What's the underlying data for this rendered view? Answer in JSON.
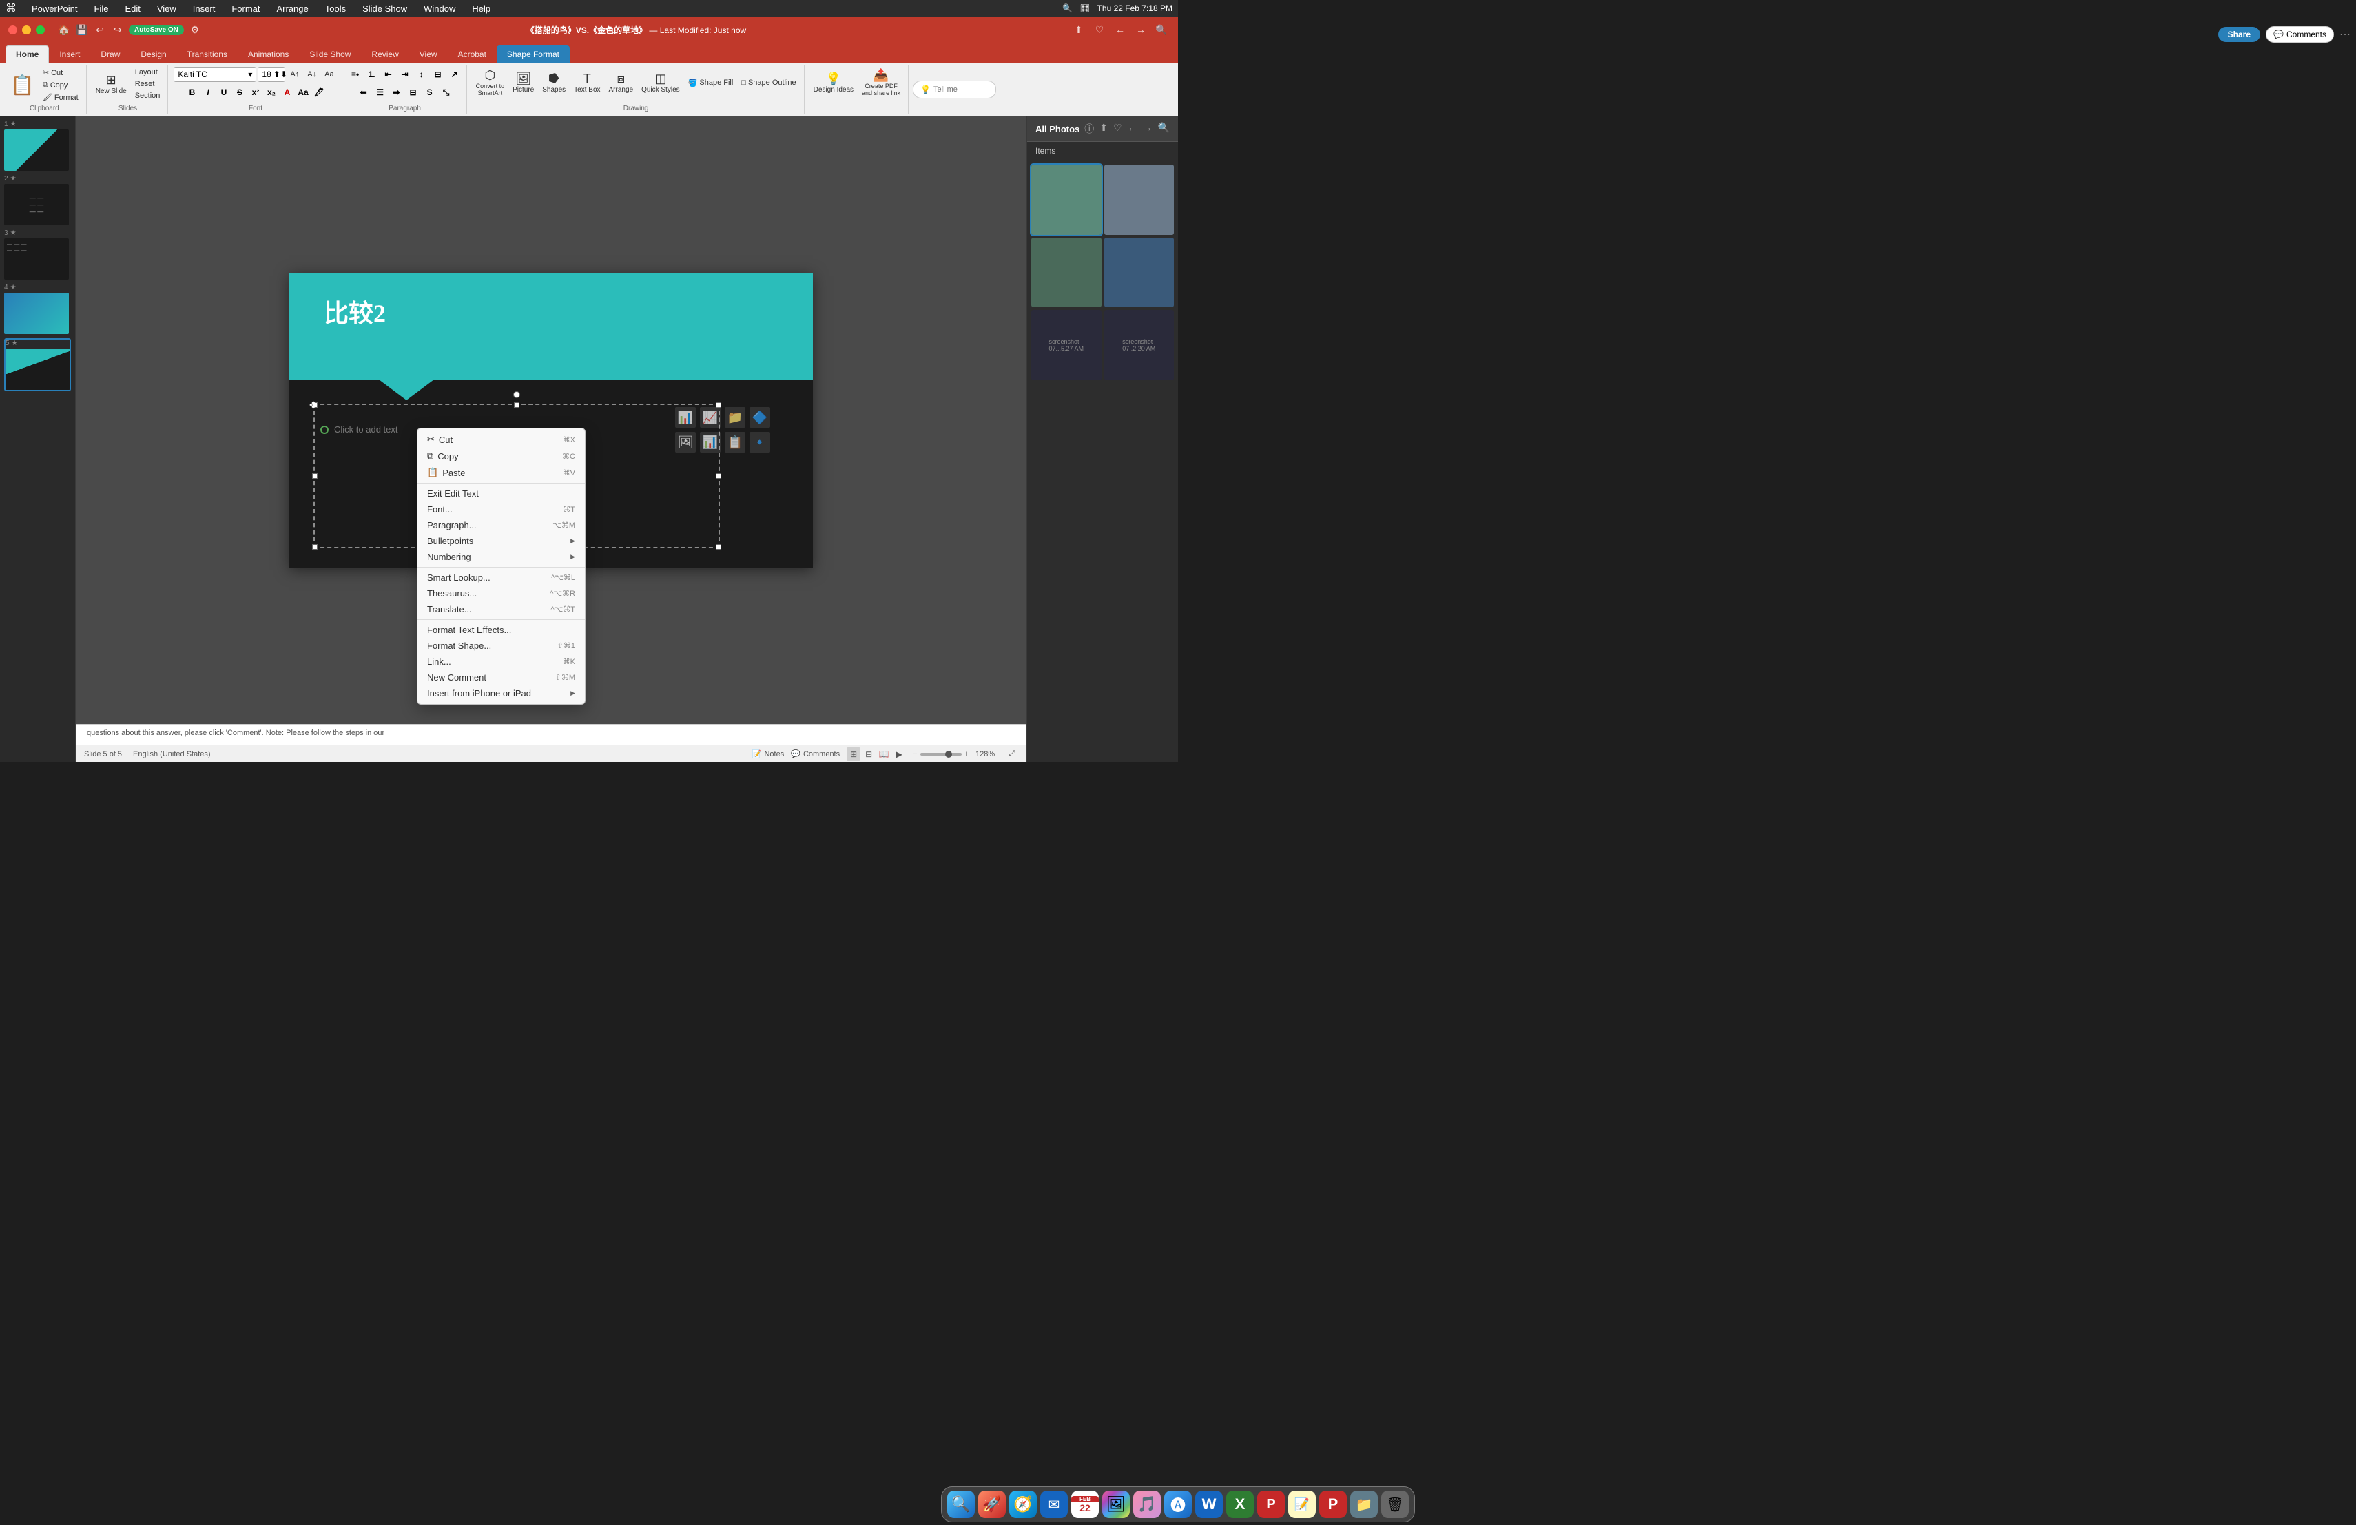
{
  "app": {
    "name": "PowerPoint",
    "title": "《搭船的鸟》VS.《金色的草地》",
    "subtitle": "— Last Modified: Just now",
    "autosave": "AutoSave ON"
  },
  "macos_menubar": {
    "items": [
      "PowerPoint",
      "File",
      "Edit",
      "View",
      "Insert",
      "Format",
      "Arrange",
      "Tools",
      "Slide Show",
      "Window",
      "Help"
    ],
    "time": "Thu 22 Feb  7:18 PM"
  },
  "ribbon": {
    "tabs": [
      "Home",
      "Insert",
      "Draw",
      "Design",
      "Transitions",
      "Animations",
      "Slide Show",
      "Review",
      "View",
      "Acrobat",
      "Shape Format"
    ],
    "active_tab": "Home",
    "contextual_tab": "Shape Format",
    "font": "Kaiti TC",
    "font_size": "18",
    "groups": {
      "clipboard": {
        "label": "Clipboard",
        "paste_label": "Paste",
        "cut_label": "Cut",
        "copy_label": "Copy",
        "format_label": "Format"
      },
      "slides": {
        "label": "Slides",
        "new_slide_label": "New Slide",
        "layout_label": "Layout",
        "reset_label": "Reset",
        "section_label": "Section"
      },
      "font": {
        "label": "Font"
      },
      "paragraph": {
        "label": "Paragraph"
      },
      "drawing": {
        "label": "Drawing",
        "shapes_label": "Shapes",
        "arrange_label": "Arrange",
        "quick_styles_label": "Quick Styles",
        "shape_fill_label": "Shape Fill",
        "shape_outline_label": "Shape Outline"
      },
      "insert": {
        "picture_label": "Picture",
        "text_box_label": "Text Box",
        "convert_label": "Convert to SmartArt"
      },
      "design": {
        "quick_styles_label": "Quick Styles",
        "design_ideas_label": "Design Ideas",
        "create_pdf_label": "Create PDF and share link"
      }
    },
    "tell_me_placeholder": "Tell me",
    "share_label": "Share",
    "comments_label": "Comments"
  },
  "slides": [
    {
      "number": "1",
      "starred": true,
      "thumb_style": "st1"
    },
    {
      "number": "2",
      "starred": true,
      "thumb_style": "st2"
    },
    {
      "number": "3",
      "starred": true,
      "thumb_style": "st3"
    },
    {
      "number": "4",
      "starred": true,
      "thumb_style": "st4"
    },
    {
      "number": "5",
      "starred": true,
      "thumb_style": "st5",
      "active": true
    }
  ],
  "current_slide": {
    "title": "比较2",
    "click_to_add_text": "Click to add text"
  },
  "context_menu": {
    "items": [
      {
        "text": "Cut",
        "shortcut": "⌘X",
        "divider_after": false
      },
      {
        "text": "Copy",
        "shortcut": "⌘C",
        "divider_after": false
      },
      {
        "text": "Paste",
        "shortcut": "⌘V",
        "divider_after": true
      },
      {
        "text": "Exit Edit Text",
        "shortcut": "",
        "divider_after": false
      },
      {
        "text": "Font...",
        "shortcut": "⌘T",
        "divider_after": false
      },
      {
        "text": "Paragraph...",
        "shortcut": "⌥⌘M",
        "divider_after": false
      },
      {
        "text": "Bulletpoints",
        "shortcut": "",
        "has_submenu": true,
        "divider_after": false
      },
      {
        "text": "Numbering",
        "shortcut": "",
        "has_submenu": true,
        "divider_after": true
      },
      {
        "text": "Smart Lookup...",
        "shortcut": "^⌥⌘L",
        "divider_after": false
      },
      {
        "text": "Thesaurus...",
        "shortcut": "^⌥⌘R",
        "divider_after": false
      },
      {
        "text": "Translate...",
        "shortcut": "^⌥⌘T",
        "divider_after": true
      },
      {
        "text": "Format Text Effects...",
        "shortcut": "",
        "divider_after": false
      },
      {
        "text": "Format Shape...",
        "shortcut": "⇧⌘1",
        "divider_after": false
      },
      {
        "text": "Link...",
        "shortcut": "⌘K",
        "divider_after": false
      },
      {
        "text": "New Comment",
        "shortcut": "⇧⌘M",
        "divider_after": false
      },
      {
        "text": "Insert from iPhone or iPad",
        "shortcut": "",
        "has_submenu": true,
        "divider_after": false
      }
    ]
  },
  "statusbar": {
    "slide_info": "Slide 5 of 5",
    "language": "English (United States)",
    "notes_label": "Notes",
    "comments_label": "Comments",
    "zoom_level": "128%"
  },
  "right_panel": {
    "title": "All Photos",
    "items_label": "Items"
  },
  "notes_bar": {
    "text": "questions about this answer, please click 'Comment'. Note: Please follow the steps in our"
  },
  "dock": {
    "items": [
      {
        "name": "finder",
        "emoji": "🔍",
        "color": "#2196F3"
      },
      {
        "name": "launchpad",
        "emoji": "🚀",
        "color": "#ff6b6b"
      },
      {
        "name": "safari-preview",
        "emoji": "🧭",
        "color": "#34aadc"
      },
      {
        "name": "mail",
        "emoji": "✉️",
        "color": "#4fc3f7"
      },
      {
        "name": "calendar",
        "emoji": "📅",
        "color": "#ff5722"
      },
      {
        "name": "photos",
        "emoji": "🖼️",
        "color": "#e91e63"
      },
      {
        "name": "music",
        "emoji": "🎵",
        "color": "#ff9800"
      },
      {
        "name": "app-store",
        "emoji": "🅐",
        "color": "#2196F3"
      },
      {
        "name": "word",
        "emoji": "W",
        "color": "#1565c0"
      },
      {
        "name": "excel",
        "emoji": "X",
        "color": "#2e7d32"
      },
      {
        "name": "pdf",
        "emoji": "P",
        "color": "#c62828"
      },
      {
        "name": "notes2",
        "emoji": "📝",
        "color": "#ffeb3b"
      },
      {
        "name": "powerpoint",
        "emoji": "P",
        "color": "#d32f2f"
      },
      {
        "name": "finder2",
        "emoji": "📁",
        "color": "#607d8b"
      },
      {
        "name": "trash",
        "emoji": "🗑️",
        "color": "#888"
      }
    ]
  }
}
